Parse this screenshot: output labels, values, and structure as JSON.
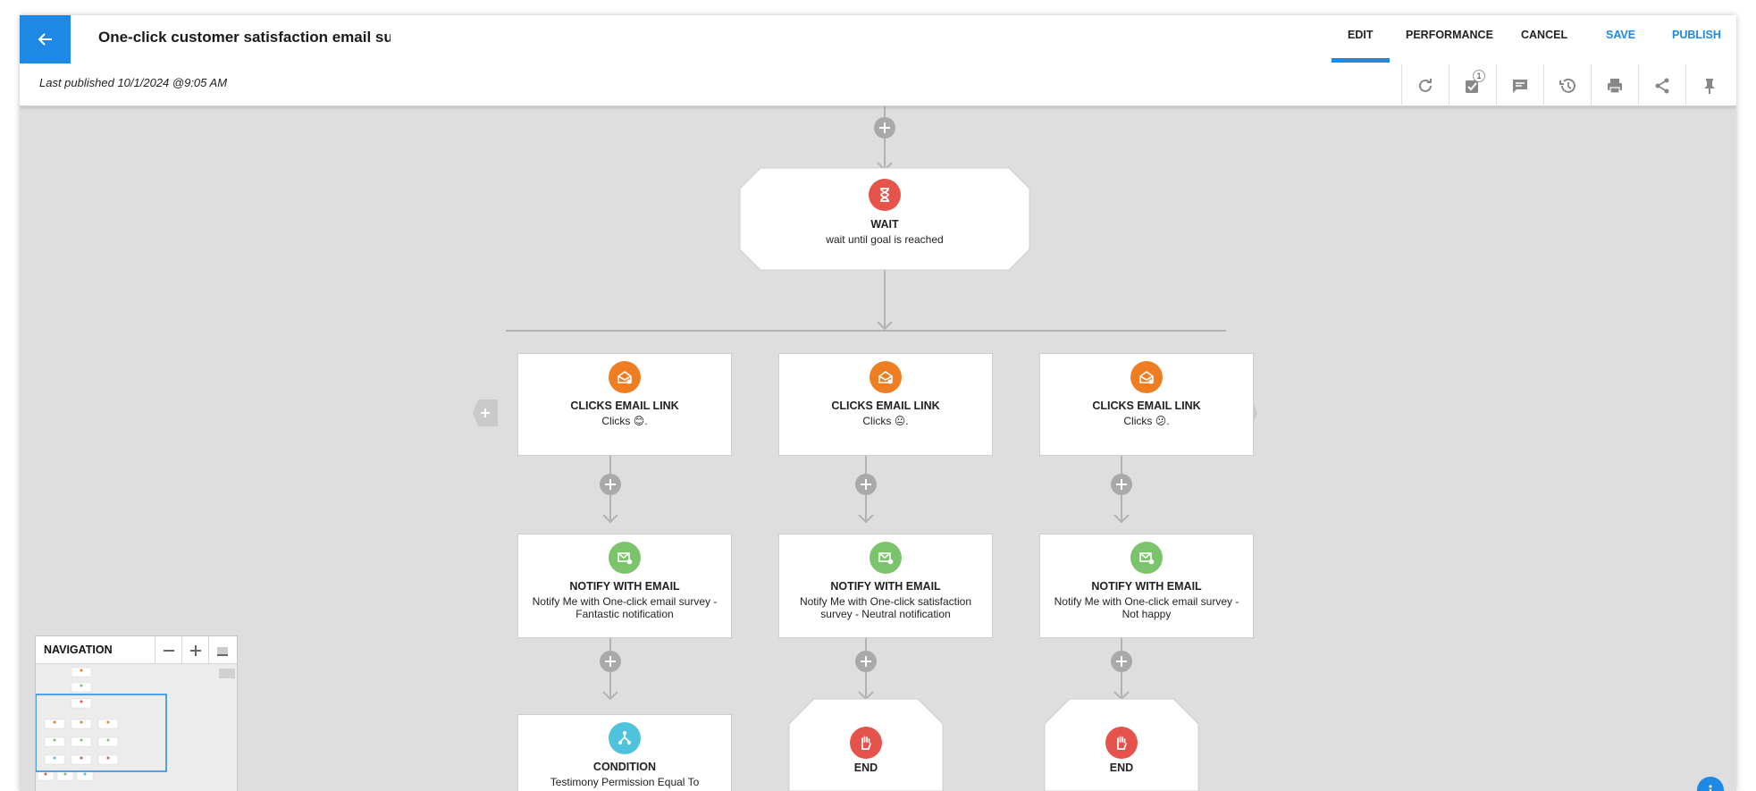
{
  "header": {
    "title": "One-click customer satisfaction email su",
    "last_published": "Last published 10/1/2024 @9:05 AM",
    "actions": {
      "edit": "EDIT",
      "performance": "PERFORMANCE",
      "cancel": "CANCEL",
      "save": "SAVE",
      "publish": "PUBLISH"
    },
    "tools": {
      "tasks_badge": "1",
      "icons": [
        "refresh-icon",
        "tasks-icon",
        "notes-icon",
        "history-icon",
        "print-icon",
        "share-icon",
        "pin-icon"
      ]
    }
  },
  "flow": {
    "wait": {
      "title": "WAIT",
      "desc": "wait until goal is reached"
    },
    "clicks": [
      {
        "title": "CLICKS EMAIL LINK",
        "desc_prefix": "Clicks",
        "emoji": "😊",
        "desc_suffix": "."
      },
      {
        "title": "CLICKS EMAIL LINK",
        "desc_prefix": "Clicks",
        "emoji": "😐",
        "desc_suffix": "."
      },
      {
        "title": "CLICKS EMAIL LINK",
        "desc_prefix": "Clicks",
        "emoji": "😕",
        "desc_suffix": "."
      }
    ],
    "notify": [
      {
        "title": "NOTIFY WITH EMAIL",
        "desc": "Notify Me with One-click email survey - Fantastic notification"
      },
      {
        "title": "NOTIFY WITH EMAIL",
        "desc": "Notify Me with One-click satisfaction survey - Neutral notification"
      },
      {
        "title": "NOTIFY WITH EMAIL",
        "desc": "Notify Me with One-click email survey - Not happy"
      }
    ],
    "condition": {
      "title": "CONDITION",
      "desc": "Testimony Permission Equal To"
    },
    "ends": [
      {
        "title": "END"
      },
      {
        "title": "END"
      }
    ]
  },
  "navigation": {
    "title": "NAVIGATION"
  },
  "colors": {
    "accent": "#1e88e5",
    "wait": "#e5534b",
    "clicks": "#ef7d22",
    "notify": "#7cc46b",
    "condition": "#4fc3dc",
    "end": "#e5534b",
    "canvas": "#dedede"
  }
}
